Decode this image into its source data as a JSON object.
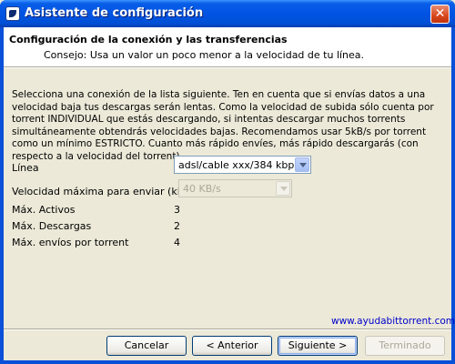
{
  "window": {
    "title": "Asistente de configuración",
    "close_glyph": "✕"
  },
  "header": {
    "title": "Configuración de la conexión y las transferencias",
    "subtitle": "Consejo: Usa un valor un poco menor a la velocidad de tu línea."
  },
  "description": "Selecciona una conexión de la lista siguiente. Ten en cuenta que si envías datos a una velocidad baja tus descargas serán lentas. Como la velocidad de subida sólo cuenta por torrent INDIVIDUAL que estás descargando, si intentas descargar muchos torrents simultáneamente obtendrás velocidades bajas. Recomendamos usar 5kB/s por torrent como un mínimo ESTRICTO. Cuanto más rápido envíes, más rápido descargarás (con respecto a la velocidad del torrent).",
  "form": {
    "line_label": "Línea",
    "line_value": "adsl/cable xxx/384 kbps",
    "max_upload_label": "Velocidad máxima para enviar (kB/s)",
    "max_upload_value": "40 KB/s",
    "max_active_label": "Máx. Activos",
    "max_active_value": "3",
    "max_downloads_label": "Máx. Descargas",
    "max_downloads_value": "2",
    "max_uploads_label": "Máx. envíos por torrent",
    "max_uploads_value": "4"
  },
  "link": "www.ayudabittorrent.com",
  "buttons": {
    "cancel": "Cancelar",
    "back": "< Anterior",
    "next": "Siguiente >",
    "finish": "Terminado"
  },
  "colors": {
    "titlebar": "#0054e3",
    "dialog_bg": "#ece9d8",
    "link": "#0000cc"
  },
  "icons": {
    "app": "app-icon",
    "close": "close-icon",
    "dropdown": "chevron-down-icon"
  }
}
